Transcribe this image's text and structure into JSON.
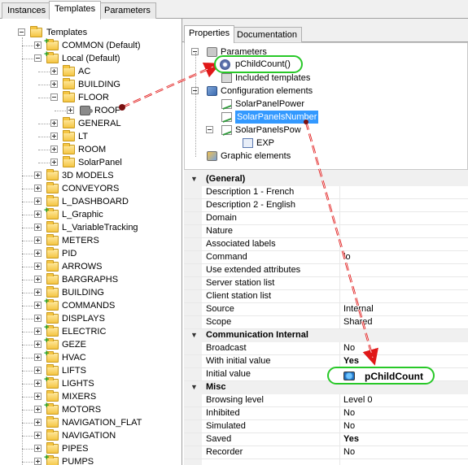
{
  "top_tabs": [
    "Instances",
    "Templates",
    "Parameters"
  ],
  "active_top_tab": "Templates",
  "left_tree": {
    "root": "Templates",
    "nodes": [
      {
        "label": "COMMON (Default)",
        "level": 1,
        "expander": "plus"
      },
      {
        "label": "Local (Default)",
        "level": 1,
        "expander": "minus"
      },
      {
        "label": "AC",
        "level": 2,
        "expander": "plus"
      },
      {
        "label": "BUILDING",
        "level": 2,
        "expander": "plus"
      },
      {
        "label": "FLOOR",
        "level": 2,
        "expander": "minus"
      },
      {
        "label": "ROOF",
        "level": 3,
        "expander": "plus"
      },
      {
        "label": "GENERAL",
        "level": 2,
        "expander": "plus"
      },
      {
        "label": "LT",
        "level": 2,
        "expander": "plus"
      },
      {
        "label": "ROOM",
        "level": 2,
        "expander": "plus"
      },
      {
        "label": "SolarPanel",
        "level": 2,
        "expander": "plus"
      },
      {
        "label": "3D MODELS",
        "level": 1,
        "expander": "plus"
      },
      {
        "label": "CONVEYORS",
        "level": 1,
        "expander": "plus"
      },
      {
        "label": "L_DASHBOARD",
        "level": 1,
        "expander": "plus"
      },
      {
        "label": "L_Graphic",
        "level": 1,
        "expander": "plus"
      },
      {
        "label": "L_VariableTracking",
        "level": 1,
        "expander": "plus"
      },
      {
        "label": "METERS",
        "level": 1,
        "expander": "plus"
      },
      {
        "label": "PID",
        "level": 1,
        "expander": "plus"
      },
      {
        "label": "ARROWS",
        "level": 1,
        "expander": "plus"
      },
      {
        "label": "BARGRAPHS",
        "level": 1,
        "expander": "plus"
      },
      {
        "label": "BUILDING",
        "level": 1,
        "expander": "plus"
      },
      {
        "label": "COMMANDS",
        "level": 1,
        "expander": "plus"
      },
      {
        "label": "DISPLAYS",
        "level": 1,
        "expander": "plus"
      },
      {
        "label": "ELECTRIC",
        "level": 1,
        "expander": "plus"
      },
      {
        "label": "GEZE",
        "level": 1,
        "expander": "plus"
      },
      {
        "label": "HVAC",
        "level": 1,
        "expander": "plus"
      },
      {
        "label": "LIFTS",
        "level": 1,
        "expander": "plus"
      },
      {
        "label": "LIGHTS",
        "level": 1,
        "expander": "plus"
      },
      {
        "label": "MIXERS",
        "level": 1,
        "expander": "plus"
      },
      {
        "label": "MOTORS",
        "level": 1,
        "expander": "plus"
      },
      {
        "label": "NAVIGATION_FLAT",
        "level": 1,
        "expander": "plus"
      },
      {
        "label": "NAVIGATION",
        "level": 1,
        "expander": "plus"
      },
      {
        "label": "PIPES",
        "level": 1,
        "expander": "plus"
      },
      {
        "label": "PUMPS",
        "level": 1,
        "expander": "plus"
      }
    ]
  },
  "right_tabs": [
    "Properties",
    "Documentation"
  ],
  "active_right_tab": "Properties",
  "right_tree": {
    "nodes": [
      {
        "label": "Parameters",
        "icon": "parameters-icon"
      },
      {
        "label": "Included templates",
        "icon": "include-icon"
      },
      {
        "label": "Configuration elements",
        "icon": "configuration-icon"
      },
      {
        "label": "SolarPanelPower",
        "icon": "graph-icon"
      },
      {
        "label": "SolarPanelsNumber",
        "icon": "graph-icon",
        "selected": true
      },
      {
        "label": "SolarPanelsPow",
        "icon": "graph-icon"
      },
      {
        "label": "EXP",
        "icon": "expression-icon"
      },
      {
        "label": "Graphic elements",
        "icon": "graphic-elements-icon"
      }
    ]
  },
  "property_grid": {
    "rows": [
      {
        "type": "category",
        "name": "(General)"
      },
      {
        "name": "Description 1 - French",
        "value": ""
      },
      {
        "name": "Description 2 - English",
        "value": ""
      },
      {
        "name": "Domain",
        "value": ""
      },
      {
        "name": "Nature",
        "value": ""
      },
      {
        "name": "Associated labels",
        "value": ""
      },
      {
        "name": "Command",
        "value": "lo"
      },
      {
        "name": "Use extended attributes",
        "value": ""
      },
      {
        "name": "Server station list",
        "value": ""
      },
      {
        "name": "Client station list",
        "value": ""
      },
      {
        "name": "Source",
        "value": "Internal"
      },
      {
        "name": "Scope",
        "value": "Shared"
      },
      {
        "type": "category",
        "name": "Communication Internal"
      },
      {
        "name": "Broadcast",
        "value": "No"
      },
      {
        "name": "With initial value",
        "value": "Yes",
        "bold": true
      },
      {
        "name": "Initial value",
        "value": ""
      },
      {
        "type": "category",
        "name": "Misc"
      },
      {
        "name": "Browsing level",
        "value": "Level 0"
      },
      {
        "name": "Inhibited",
        "value": "No"
      },
      {
        "name": "Simulated",
        "value": "No"
      },
      {
        "name": "Saved",
        "value": "Yes",
        "bold": true
      },
      {
        "name": "Recorder",
        "value": "No"
      },
      {
        "name": "",
        "value": ""
      }
    ]
  },
  "annotations": {
    "callout_top": "pChildCount()",
    "callout_bottom": "pChildCount",
    "arrow_color": "#e01818",
    "callout_border_color": "#28c828"
  }
}
